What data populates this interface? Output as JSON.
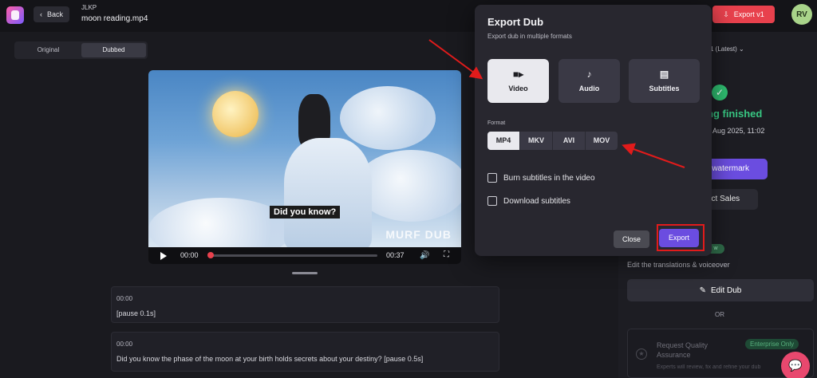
{
  "topbar": {
    "back_label": "Back",
    "workspace": "JLKP",
    "file_name": "moon reading.mp4",
    "export_label": "Export v1",
    "avatar_initials": "RV"
  },
  "view_toggle": {
    "options": [
      "Original",
      "Dubbed"
    ],
    "selected": "Dubbed"
  },
  "player": {
    "caption": "Did you know?",
    "watermark": "MURF DUB",
    "current_time": "00:00",
    "duration": "00:37",
    "progress": 0
  },
  "transcript": [
    {
      "time": "00:00",
      "text": "[pause 0.1s]"
    },
    {
      "time": "00:00",
      "text": "Did you know the phase of the moon at your birth holds secrets about your destiny? [pause 0.5s]"
    }
  ],
  "right_panel": {
    "version_label": "1 (Latest)",
    "status": "ng finished",
    "date": "3 Aug 2025, 11:02",
    "watermark_btn": "e watermark",
    "sales_btn": "act Sales",
    "new_tag": "w",
    "edit_desc": "Edit the translations & voiceover",
    "edit_btn": "Edit Dub",
    "or_text": "OR",
    "quality_title": "Request Quality Assurance",
    "quality_badge": "Enterprise Only",
    "quality_desc": "Experts will review, fix and refine your dub"
  },
  "modal": {
    "title": "Export Dub",
    "subtitle": "Export dub in multiple formats",
    "type_cards": [
      {
        "label": "Video",
        "icon": "video-camera-icon",
        "selected": true
      },
      {
        "label": "Audio",
        "icon": "music-note-icon",
        "selected": false
      },
      {
        "label": "Subtitles",
        "icon": "subtitles-icon",
        "selected": false
      }
    ],
    "format_label": "Format",
    "formats": [
      "MP4",
      "MKV",
      "AVI",
      "MOV"
    ],
    "selected_format": "MP4",
    "burn_label": "Burn subtitles in the video",
    "download_label": "Download subtitles",
    "close_label": "Close",
    "export_label": "Export"
  },
  "colors": {
    "accent": "#6b4de0",
    "export_red": "#e8414d",
    "success": "#38c883",
    "annotation_red": "#e11b1b"
  }
}
